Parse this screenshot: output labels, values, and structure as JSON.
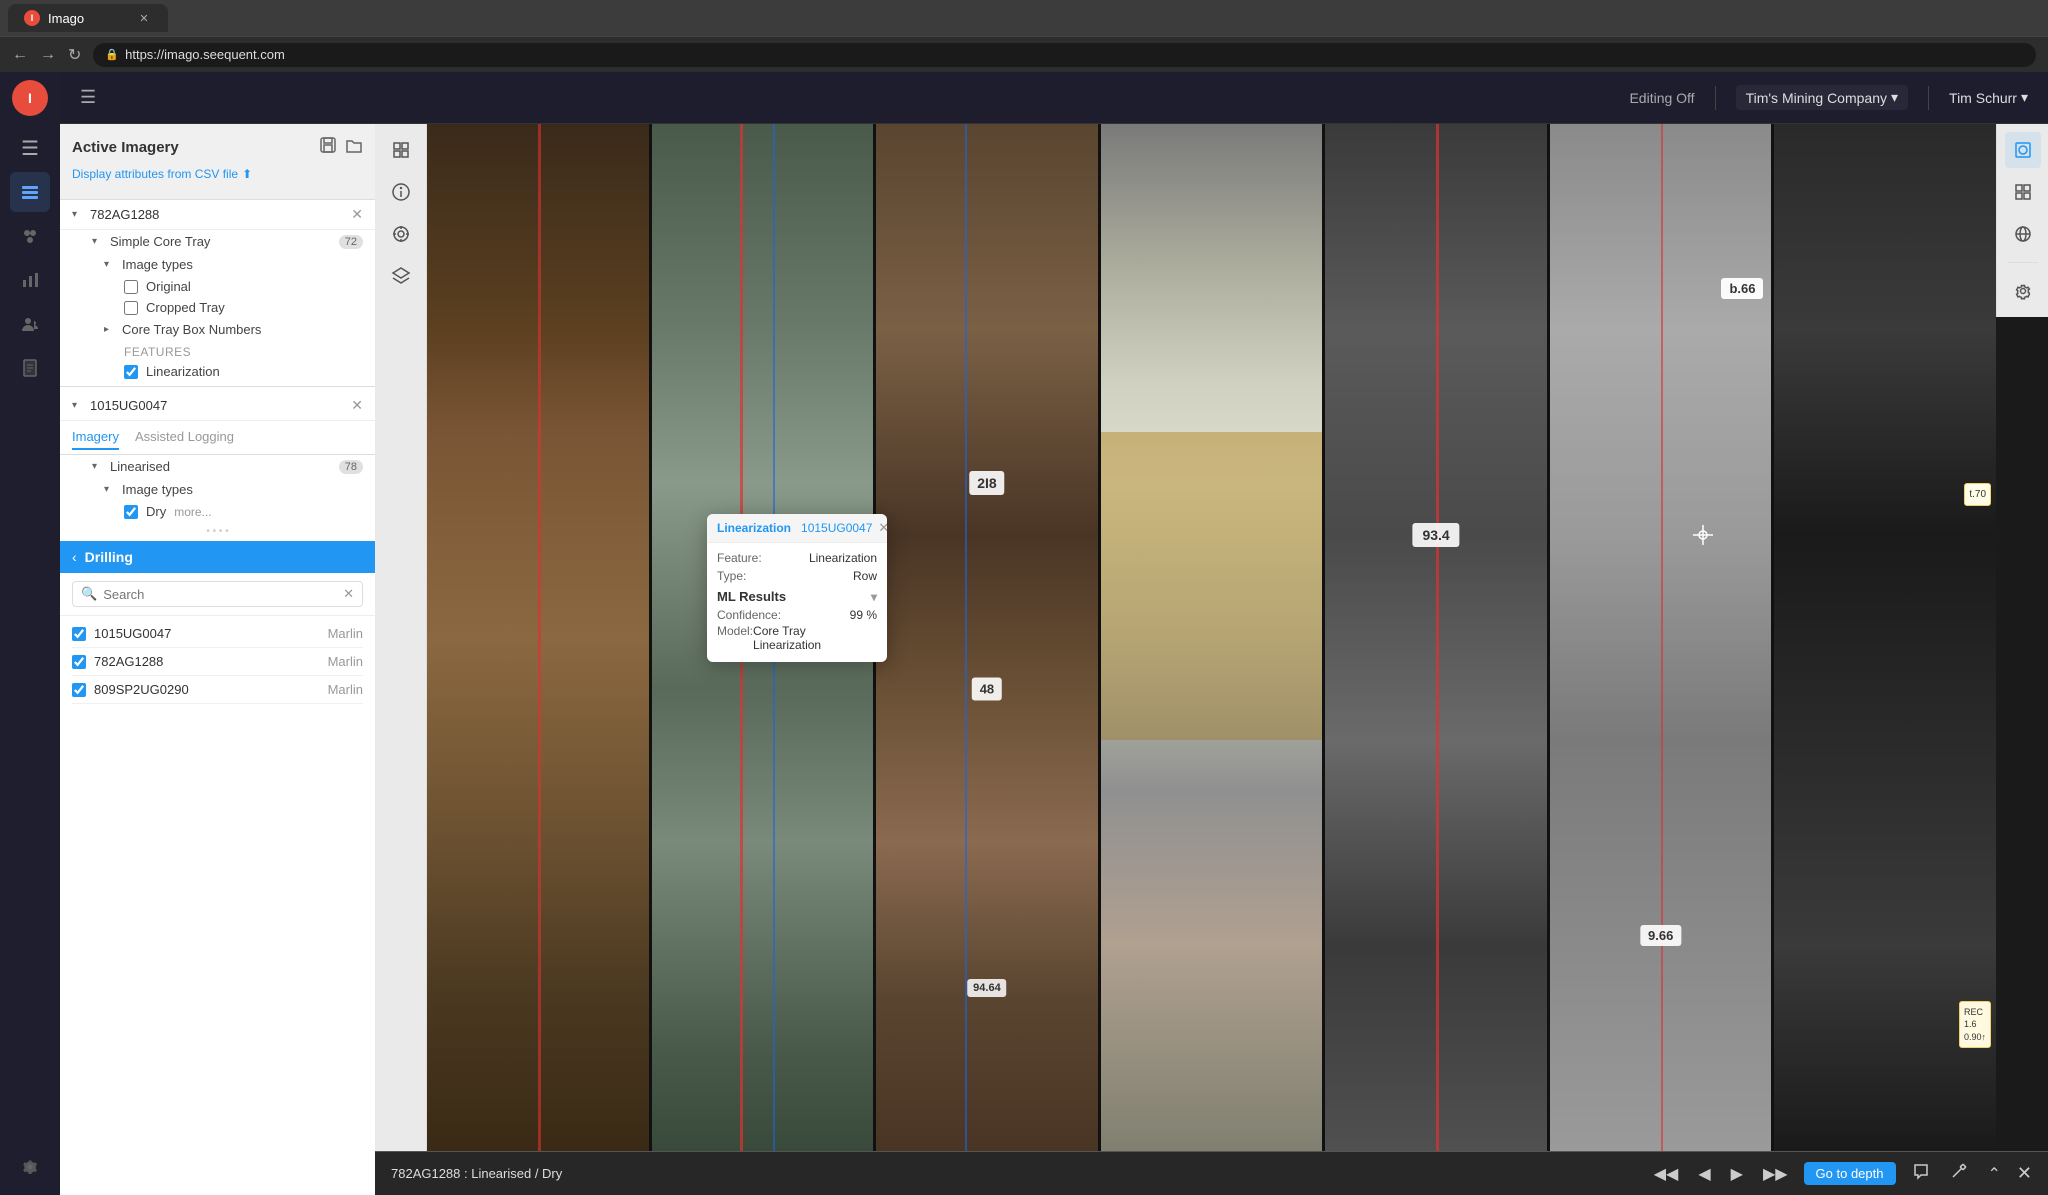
{
  "browser": {
    "tab_label": "Imago",
    "url": "https://imago.seequent.com"
  },
  "header": {
    "editing_off_label": "Editing Off",
    "company_label": "Tim's Mining Company",
    "user_label": "Tim Schurr",
    "hamburger_icon": "☰"
  },
  "left_panel": {
    "active_imagery_title": "Active Imagery",
    "csv_link_label": "Display attributes from CSV file",
    "entry1": {
      "id": "782AG1288",
      "simple_core_tray_label": "Simple Core Tray",
      "badge": "72",
      "image_types_label": "Image types",
      "original_label": "Original",
      "cropped_tray_label": "Cropped Tray",
      "core_tray_box_label": "Core Tray Box Numbers",
      "features_label": "Features",
      "linearization_label": "Linearization"
    },
    "entry2": {
      "id": "1015UG0047",
      "imagery_tab": "Imagery",
      "assisted_logging_tab": "Assisted Logging",
      "linearised_label": "Linearised",
      "badge": "78",
      "image_types_label": "Image types",
      "dry_label": "Dry",
      "more_label": "more..."
    },
    "drilling": {
      "back_label": "Drilling",
      "search_placeholder": "Search",
      "items": [
        {
          "id": "1015UG0047",
          "tag": "Marlin",
          "checked": true
        },
        {
          "id": "782AG1288",
          "tag": "Marlin",
          "checked": true
        },
        {
          "id": "809SP2UG0290",
          "tag": "Marlin",
          "checked": true
        }
      ]
    }
  },
  "popup": {
    "tab1": "Linearization",
    "tab2": "1015UG0047",
    "feature_label": "Feature:",
    "feature_value": "Linearization",
    "type_label": "Type:",
    "type_value": "Row",
    "ml_results_label": "ML Results",
    "confidence_label": "Confidence:",
    "confidence_value": "99 %",
    "model_label": "Model:",
    "model_value": "Core Tray Linearization"
  },
  "bottom_bar": {
    "status_text": "782AG1288 : Linearised / Dry",
    "go_to_depth_label": "Go to depth",
    "close_icon": "✕"
  },
  "right_toolbar": {
    "icons": [
      "⊞",
      "⊟",
      "⊕",
      "⊗"
    ]
  },
  "left_vertical_toolbar": {
    "icons": [
      "⊟",
      "◉",
      "◈",
      "⊕"
    ]
  },
  "colors": {
    "accent_blue": "#2196F3",
    "dark_bg": "#1e1e2e",
    "panel_bg": "#f5f5f5",
    "drilling_blue": "#2196F3"
  }
}
